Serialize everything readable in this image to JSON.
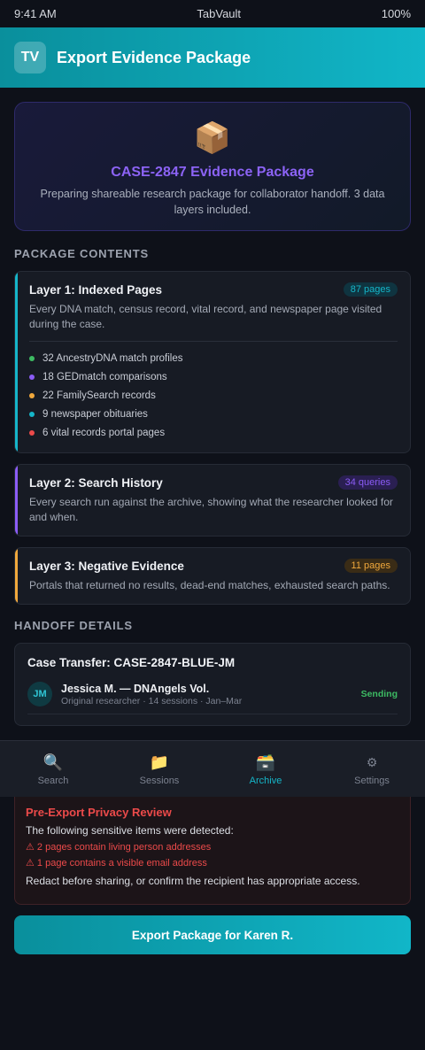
{
  "status_bar": {
    "time": "9:41 AM",
    "app": "TabVault",
    "battery": "100%"
  },
  "header": {
    "logo": "TV",
    "title": "Export Evidence Package"
  },
  "hero": {
    "icon": "📦",
    "title": "CASE-2847 Evidence Package",
    "subtitle": "Preparing shareable research package for collaborator handoff. 3 data layers included."
  },
  "package_contents": {
    "section_title": "PACKAGE CONTENTS",
    "layers": [
      {
        "title": "Layer 1: Indexed Pages",
        "badge": "87 pages",
        "accent": "#15b6c9",
        "badge_bg": "#0f3440",
        "description": "Every DNA match, census record, vital record, and newspaper page visited during the case.",
        "items": [
          {
            "label": "32 AncestryDNA match profiles",
            "color": "#3dbb63"
          },
          {
            "label": "18 GEDmatch comparisons",
            "color": "#8b5cf6"
          },
          {
            "label": "22 FamilySearch records",
            "color": "#f0a83c"
          },
          {
            "label": "9 newspaper obituaries",
            "color": "#15b6c9"
          },
          {
            "label": "6 vital records portal pages",
            "color": "#ec4a4a"
          }
        ]
      },
      {
        "title": "Layer 2: Search History",
        "badge": "34 queries",
        "accent": "#8b5cf6",
        "badge_bg": "#2a1f52",
        "description": "Every search run against the archive, showing what the researcher looked for and when."
      },
      {
        "title": "Layer 3: Negative Evidence",
        "badge": "11 pages",
        "accent": "#f0a83c",
        "badge_bg": "#3a2c16",
        "description": "Portals that returned no results, dead-end matches, exhausted search paths."
      }
    ]
  },
  "handoff": {
    "section_title": "HANDOFF DETAILS",
    "title": "Case Transfer: CASE-2847-BLUE-JM",
    "person": {
      "initials": "JM",
      "name": "Jessica M. — DNAngels Vol.",
      "meta": "Original researcher · 14 sessions · Jan–Mar",
      "status": "Sending"
    }
  },
  "tabbar": {
    "tabs": [
      {
        "label": "Search",
        "icon": "🔍",
        "active": false
      },
      {
        "label": "Sessions",
        "icon": "📁",
        "active": false
      },
      {
        "label": "Archive",
        "icon": "🗃️",
        "active": true
      },
      {
        "label": "Settings",
        "icon": "⚙",
        "active": false
      }
    ]
  },
  "privacy": {
    "title": "Pre-Export Privacy Review",
    "intro": "The following sensitive items were detected:",
    "warnings": [
      "⚠ 2 pages contain living person addresses",
      "⚠ 1 page contains a visible email address"
    ],
    "footer": "Redact before sharing, or confirm the recipient has appropriate access."
  },
  "export_button": {
    "label": "Export Package for Karen R."
  }
}
